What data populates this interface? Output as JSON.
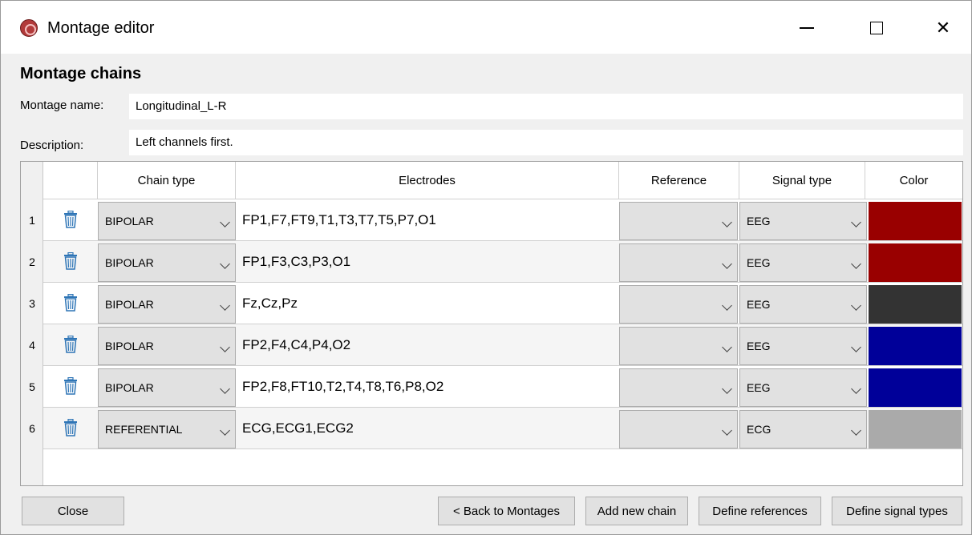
{
  "window": {
    "title": "Montage editor"
  },
  "heading": "Montage chains",
  "form": {
    "name_label": "Montage name:",
    "name_value": "Longitudinal_L-R",
    "desc_label": "Description:",
    "desc_value": "Left channels first."
  },
  "table": {
    "headers": {
      "chain_type": "Chain type",
      "electrodes": "Electrodes",
      "reference": "Reference",
      "signal_type": "Signal type",
      "color": "Color"
    },
    "rows": [
      {
        "num": "1",
        "chain_type": "BIPOLAR",
        "electrodes": "FP1,F7,FT9,T1,T3,T7,T5,P7,O1",
        "reference": "",
        "signal_type": "EEG",
        "color": "#990000"
      },
      {
        "num": "2",
        "chain_type": "BIPOLAR",
        "electrodes": "FP1,F3,C3,P3,O1",
        "reference": "",
        "signal_type": "EEG",
        "color": "#990000"
      },
      {
        "num": "3",
        "chain_type": "BIPOLAR",
        "electrodes": "Fz,Cz,Pz",
        "reference": "",
        "signal_type": "EEG",
        "color": "#333333"
      },
      {
        "num": "4",
        "chain_type": "BIPOLAR",
        "electrodes": "FP2,F4,C4,P4,O2",
        "reference": "",
        "signal_type": "EEG",
        "color": "#000099"
      },
      {
        "num": "5",
        "chain_type": "BIPOLAR",
        "electrodes": "FP2,F8,FT10,T2,T4,T8,T6,P8,O2",
        "reference": "",
        "signal_type": "EEG",
        "color": "#000099"
      },
      {
        "num": "6",
        "chain_type": "REFERENTIAL",
        "electrodes": "ECG,ECG1,ECG2",
        "reference": "",
        "signal_type": "ECG",
        "color": "#aaaaaa"
      }
    ]
  },
  "buttons": {
    "close": "Close",
    "back": "< Back to Montages",
    "add": "Add new chain",
    "define_refs": "Define references",
    "define_signals": "Define signal types"
  },
  "colors": {
    "trash_icon": "#2e75b6"
  }
}
